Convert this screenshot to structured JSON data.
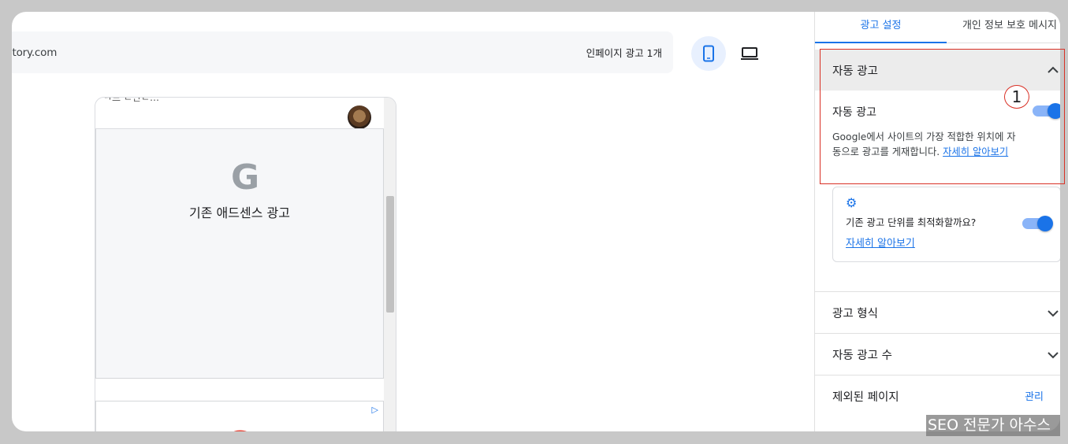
{
  "preview": {
    "url": "tistory.com",
    "inpage_ads": "인페이지 광고 1개",
    "phone_partial_text": "ㅋ드 ㄴ만ㄷ…",
    "ad1_label": "기존 애드센스 광고",
    "ad1_logo": "G",
    "ad2_logo": "G",
    "ad2_adchoice": "▷",
    "devices": [
      "mobile-icon",
      "laptop-icon"
    ]
  },
  "panel": {
    "tabs": [
      "광고 설정",
      "개인 정보 보호 메시지"
    ],
    "auto_ads_section": "자동 광고",
    "auto_ads_toggle_label": "자동 광고",
    "auto_ads_description": "Google에서 사이트의 가장 적합한 위치에 자동으로 광고를 게재합니다.",
    "learn_more": "자세히 알아보기",
    "optimize_question": "기존 광고 단위를 최적화할까요?",
    "optimize_link": "자세히 알아보기",
    "sections": [
      "광고 형식",
      "자동 광고 수",
      "제외된 페이지"
    ],
    "manage": "관리"
  },
  "annotation_number": "1",
  "watermark": "SEO 전문가 아수스",
  "colors": {
    "accent": "#1a73e8",
    "annotation": "#d93025"
  }
}
